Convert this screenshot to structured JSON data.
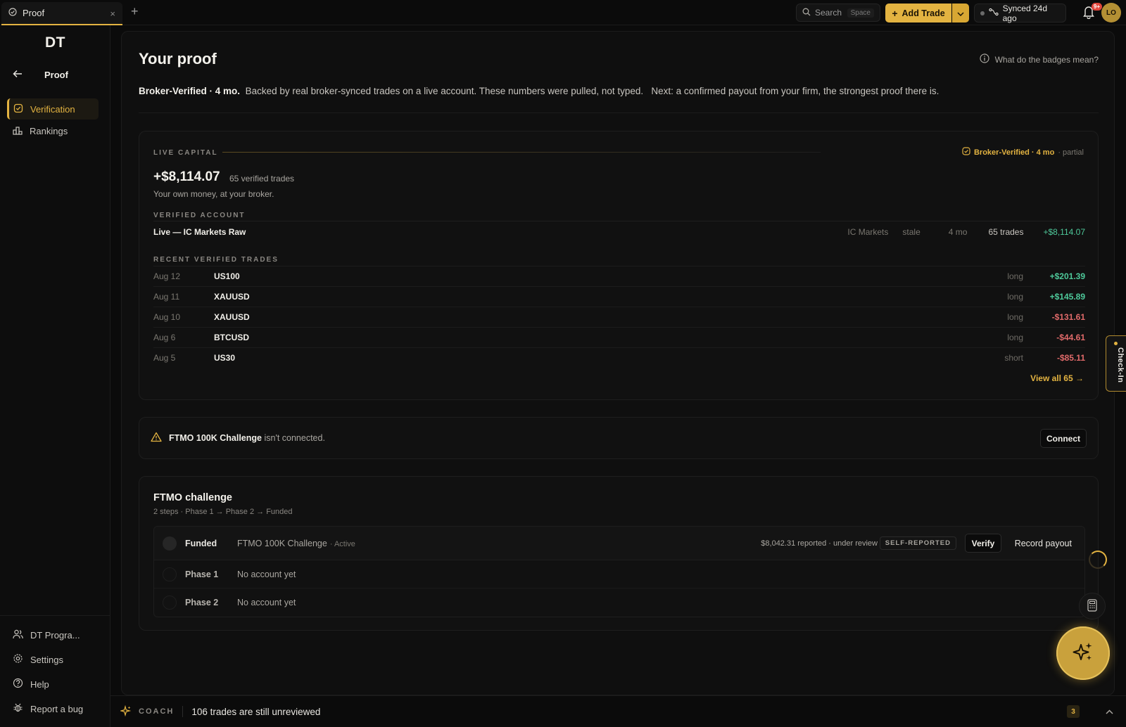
{
  "topbar": {
    "tab_title": "Proof",
    "new_tab_symbol": "+",
    "close_symbol": "×",
    "search_label": "Search",
    "search_shortcut": "Space",
    "add_trade_label": "Add Trade",
    "sync_label": "Synced 24d ago",
    "notification_badge": "9+",
    "avatar_initials": "LO"
  },
  "sidebar": {
    "logo": "DT",
    "section_title": "Proof",
    "nav": [
      {
        "label": "Verification",
        "icon": "badge-check-icon",
        "active": true
      },
      {
        "label": "Rankings",
        "icon": "podium-icon",
        "active": false
      }
    ],
    "bottom": [
      {
        "label": "DT Progra...",
        "icon": "users-icon"
      },
      {
        "label": "Settings",
        "icon": "gear-icon"
      },
      {
        "label": "Help",
        "icon": "help-circle-icon"
      },
      {
        "label": "Report a bug",
        "icon": "bug-icon"
      }
    ]
  },
  "main": {
    "title": "Your proof",
    "badges_help": "What do the badges mean?",
    "intro": {
      "headline": "Broker-Verified · 4 mo.",
      "body": "Backed by real broker-synced trades on a live account. These numbers were pulled, not typed.",
      "next": "Next: a confirmed payout from your firm, the strongest proof there is."
    }
  },
  "live_capital": {
    "label": "LIVE CAPITAL",
    "badge": "Broker-Verified · 4 mo",
    "badge_suffix": "· partial",
    "amount": "+$8,114.07",
    "verified_trades": "65 verified trades",
    "subtext": "Your own money, at your broker.",
    "verified_account_label": "VERIFIED ACCOUNT",
    "account": {
      "name": "Live — IC Markets Raw",
      "broker": "IC Markets",
      "status": "stale",
      "age": "4 mo",
      "trades": "65 trades",
      "pnl": "+$8,114.07"
    },
    "recent_label": "RECENT VERIFIED TRADES",
    "trades": [
      {
        "date": "Aug 12",
        "symbol": "US100",
        "side": "long",
        "pnl": "+$201.39",
        "positive": true
      },
      {
        "date": "Aug 11",
        "symbol": "XAUUSD",
        "side": "long",
        "pnl": "+$145.89",
        "positive": true
      },
      {
        "date": "Aug 10",
        "symbol": "XAUUSD",
        "side": "long",
        "pnl": "-$131.61",
        "positive": false
      },
      {
        "date": "Aug 6",
        "symbol": "BTCUSD",
        "side": "long",
        "pnl": "-$44.61",
        "positive": false
      },
      {
        "date": "Aug 5",
        "symbol": "US30",
        "side": "short",
        "pnl": "-$85.11",
        "positive": false
      }
    ],
    "view_all": "View all 65 →"
  },
  "warning": {
    "account_name": "FTMO 100K Challenge",
    "message": "isn't connected.",
    "connect_label": "Connect"
  },
  "ftmo": {
    "title": "FTMO challenge",
    "subtitle": "2 steps · Phase 1 → Phase 2 → Funded",
    "steps": [
      {
        "name": "Funded",
        "desc": "FTMO 100K Challenge",
        "status": "· Active",
        "reported": "$8,042.31 reported · under review",
        "tag": "SELF-REPORTED",
        "verify_label": "Verify",
        "payout_label": "Record payout"
      },
      {
        "name": "Phase 1",
        "desc": "No account yet"
      },
      {
        "name": "Phase 2",
        "desc": "No account yet"
      }
    ]
  },
  "coach": {
    "label": "COACH",
    "message": "106 trades are still unreviewed",
    "count": "3"
  },
  "widgets": {
    "checkin_label": "Check-In"
  },
  "colors": {
    "accent": "#e3b341",
    "positive": "#4ec99a",
    "negative": "#e06a6a",
    "background": "#0b0b0b"
  }
}
